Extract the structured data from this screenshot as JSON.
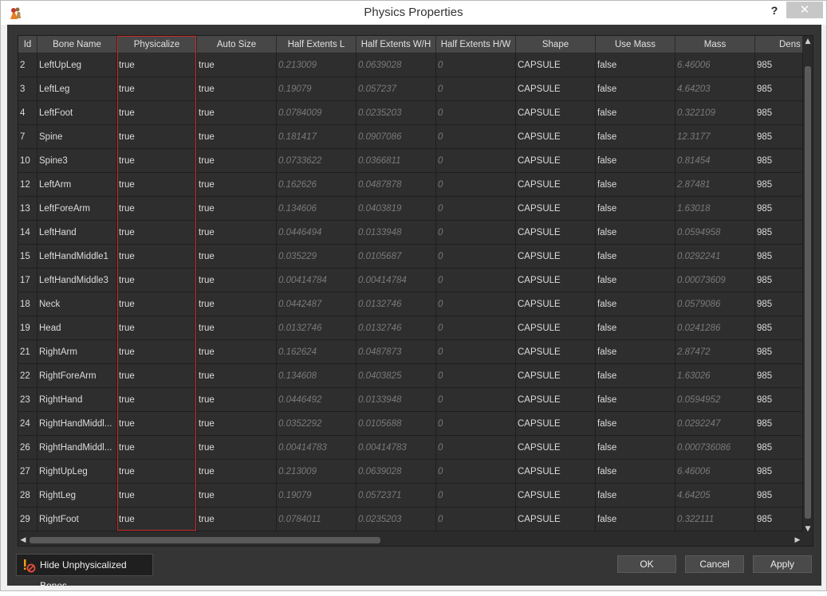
{
  "window": {
    "title": "Physics Properties",
    "help": "?",
    "close": "✕"
  },
  "columns": [
    "Id",
    "Bone Name",
    "Physicalize",
    "Auto Size",
    "Half Extents L",
    "Half Extents W/H",
    "Half Extents H/W",
    "Shape",
    "Use Mass",
    "Mass",
    "Dens"
  ],
  "rows": [
    [
      "2",
      "LeftUpLeg",
      "true",
      "true",
      "0.213009",
      "0.0639028",
      "0",
      "CAPSULE",
      "false",
      "6.46006",
      "985"
    ],
    [
      "3",
      "LeftLeg",
      "true",
      "true",
      "0.19079",
      "0.057237",
      "0",
      "CAPSULE",
      "false",
      "4.64203",
      "985"
    ],
    [
      "4",
      "LeftFoot",
      "true",
      "true",
      "0.0784009",
      "0.0235203",
      "0",
      "CAPSULE",
      "false",
      "0.322109",
      "985"
    ],
    [
      "7",
      "Spine",
      "true",
      "true",
      "0.181417",
      "0.0907086",
      "0",
      "CAPSULE",
      "false",
      "12.3177",
      "985"
    ],
    [
      "10",
      "Spine3",
      "true",
      "true",
      "0.0733622",
      "0.0366811",
      "0",
      "CAPSULE",
      "false",
      "0.81454",
      "985"
    ],
    [
      "12",
      "LeftArm",
      "true",
      "true",
      "0.162626",
      "0.0487878",
      "0",
      "CAPSULE",
      "false",
      "2.87481",
      "985"
    ],
    [
      "13",
      "LeftForeArm",
      "true",
      "true",
      "0.134606",
      "0.0403819",
      "0",
      "CAPSULE",
      "false",
      "1.63018",
      "985"
    ],
    [
      "14",
      "LeftHand",
      "true",
      "true",
      "0.0446494",
      "0.0133948",
      "0",
      "CAPSULE",
      "false",
      "0.0594958",
      "985"
    ],
    [
      "15",
      "LeftHandMiddle1",
      "true",
      "true",
      "0.035229",
      "0.0105687",
      "0",
      "CAPSULE",
      "false",
      "0.0292241",
      "985"
    ],
    [
      "17",
      "LeftHandMiddle3",
      "true",
      "true",
      "0.00414784",
      "0.00414784",
      "0",
      "CAPSULE",
      "false",
      "0.00073609",
      "985"
    ],
    [
      "18",
      "Neck",
      "true",
      "true",
      "0.0442487",
      "0.0132746",
      "0",
      "CAPSULE",
      "false",
      "0.0579086",
      "985"
    ],
    [
      "19",
      "Head",
      "true",
      "true",
      "0.0132746",
      "0.0132746",
      "0",
      "CAPSULE",
      "false",
      "0.0241286",
      "985"
    ],
    [
      "21",
      "RightArm",
      "true",
      "true",
      "0.162624",
      "0.0487873",
      "0",
      "CAPSULE",
      "false",
      "2.87472",
      "985"
    ],
    [
      "22",
      "RightForeArm",
      "true",
      "true",
      "0.134608",
      "0.0403825",
      "0",
      "CAPSULE",
      "false",
      "1.63026",
      "985"
    ],
    [
      "23",
      "RightHand",
      "true",
      "true",
      "0.0446492",
      "0.0133948",
      "0",
      "CAPSULE",
      "false",
      "0.0594952",
      "985"
    ],
    [
      "24",
      "RightHandMiddl...",
      "true",
      "true",
      "0.0352292",
      "0.0105688",
      "0",
      "CAPSULE",
      "false",
      "0.0292247",
      "985"
    ],
    [
      "26",
      "RightHandMiddl...",
      "true",
      "true",
      "0.00414783",
      "0.00414783",
      "0",
      "CAPSULE",
      "false",
      "0.000736086",
      "985"
    ],
    [
      "27",
      "RightUpLeg",
      "true",
      "true",
      "0.213009",
      "0.0639028",
      "0",
      "CAPSULE",
      "false",
      "6.46006",
      "985"
    ],
    [
      "28",
      "RightLeg",
      "true",
      "true",
      "0.19079",
      "0.0572371",
      "0",
      "CAPSULE",
      "false",
      "4.64205",
      "985"
    ],
    [
      "29",
      "RightFoot",
      "true",
      "true",
      "0.0784011",
      "0.0235203",
      "0",
      "CAPSULE",
      "false",
      "0.322111",
      "985"
    ]
  ],
  "footer": {
    "hide_unphysicalized": "Hide Unphysicalized Bones",
    "ok": "OK",
    "cancel": "Cancel",
    "apply": "Apply"
  },
  "colors": {
    "highlight": "#d02828",
    "background": "#353535",
    "header": "#474747"
  }
}
